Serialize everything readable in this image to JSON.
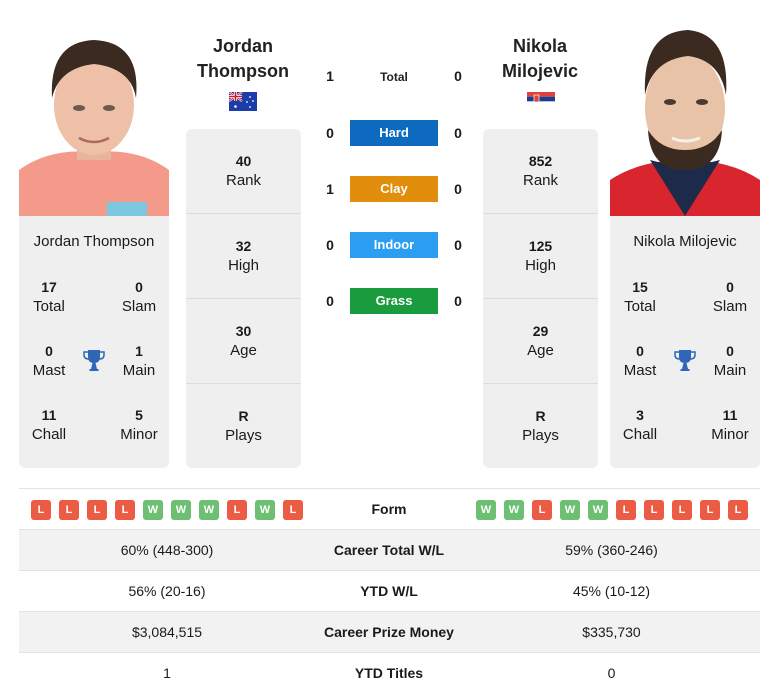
{
  "colors": {
    "hard": "#0d6abf",
    "clay": "#e08e0b",
    "indoor": "#2b9ef2",
    "grass": "#1a9c3e",
    "win": "#6cbf73",
    "loss": "#ec5b43",
    "trophy": "#2f66b7"
  },
  "player1": {
    "name": "Jordan Thompson",
    "name_line1": "Jordan",
    "name_line2": "Thompson",
    "flag": "australia-flag",
    "photo": "player-photo",
    "stats": [
      {
        "value": "40",
        "label": "Rank"
      },
      {
        "value": "32",
        "label": "High"
      },
      {
        "value": "30",
        "label": "Age"
      },
      {
        "value": "R",
        "label": "Plays"
      }
    ],
    "titles": {
      "total": {
        "value": "17",
        "label": "Total"
      },
      "slam": {
        "value": "0",
        "label": "Slam"
      },
      "mast": {
        "value": "0",
        "label": "Mast"
      },
      "main": {
        "value": "1",
        "label": "Main"
      },
      "chall": {
        "value": "11",
        "label": "Chall"
      },
      "minor": {
        "value": "5",
        "label": "Minor"
      }
    },
    "form": [
      "L",
      "L",
      "L",
      "L",
      "W",
      "W",
      "W",
      "L",
      "W",
      "L"
    ]
  },
  "player2": {
    "name": "Nikola Milojevic",
    "name_line1": "Nikola",
    "name_line2": "Milojevic",
    "flag": "serbia-flag",
    "photo": "player-photo",
    "stats": [
      {
        "value": "852",
        "label": "Rank"
      },
      {
        "value": "125",
        "label": "High"
      },
      {
        "value": "29",
        "label": "Age"
      },
      {
        "value": "R",
        "label": "Plays"
      }
    ],
    "titles": {
      "total": {
        "value": "15",
        "label": "Total"
      },
      "slam": {
        "value": "0",
        "label": "Slam"
      },
      "mast": {
        "value": "0",
        "label": "Mast"
      },
      "main": {
        "value": "0",
        "label": "Main"
      },
      "chall": {
        "value": "3",
        "label": "Chall"
      },
      "minor": {
        "value": "11",
        "label": "Minor"
      }
    },
    "form": [
      "W",
      "W",
      "L",
      "W",
      "W",
      "L",
      "L",
      "L",
      "L",
      "L"
    ]
  },
  "h2h": [
    {
      "label": "Total",
      "left": "1",
      "right": "0",
      "surface": "total"
    },
    {
      "label": "Hard",
      "left": "0",
      "right": "0",
      "surface": "hard"
    },
    {
      "label": "Clay",
      "left": "1",
      "right": "0",
      "surface": "clay"
    },
    {
      "label": "Indoor",
      "left": "0",
      "right": "0",
      "surface": "indoor"
    },
    {
      "label": "Grass",
      "left": "0",
      "right": "0",
      "surface": "grass"
    }
  ],
  "table": {
    "form_label": "Form",
    "rows": [
      {
        "label": "Career Total W/L",
        "left": "60% (448-300)",
        "right": "59% (360-246)"
      },
      {
        "label": "YTD W/L",
        "left": "56% (20-16)",
        "right": "45% (10-12)"
      },
      {
        "label": "Career Prize Money",
        "left": "$3,084,515",
        "right": "$335,730"
      },
      {
        "label": "YTD Titles",
        "left": "1",
        "right": "0"
      }
    ]
  }
}
